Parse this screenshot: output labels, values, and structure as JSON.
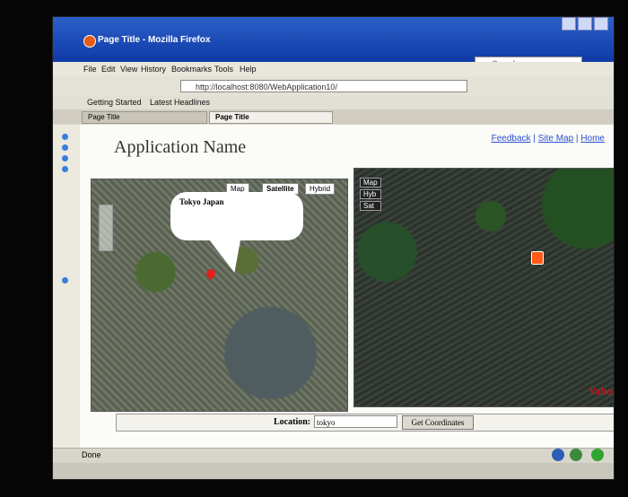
{
  "window": {
    "title": "Page Title - Mozilla Firefox"
  },
  "menu": [
    "File",
    "Edit",
    "View",
    "History",
    "Bookmarks",
    "Tools",
    "Help"
  ],
  "address": {
    "url": "http://localhost:8080/WebApplication10/"
  },
  "search": {
    "placeholder": "Google"
  },
  "bookmarks": [
    "Getting Started",
    "Latest Headlines"
  ],
  "tabs": [
    "Page Title",
    "Page Title"
  ],
  "page": {
    "title": "Application Name",
    "links": [
      "Feedback",
      "Site Map",
      "Home"
    ]
  },
  "map_left": {
    "types": [
      "Map",
      "Satellite",
      "Hybrid"
    ],
    "bubble": "Tokyo Japan"
  },
  "map_right": {
    "types": [
      "Map",
      "Hyb",
      "Sat"
    ],
    "brand": "Yahoo!"
  },
  "location": {
    "label": "Location:",
    "value": "tokyo",
    "button": "Get Coordinates"
  },
  "status": {
    "text": "Done"
  }
}
